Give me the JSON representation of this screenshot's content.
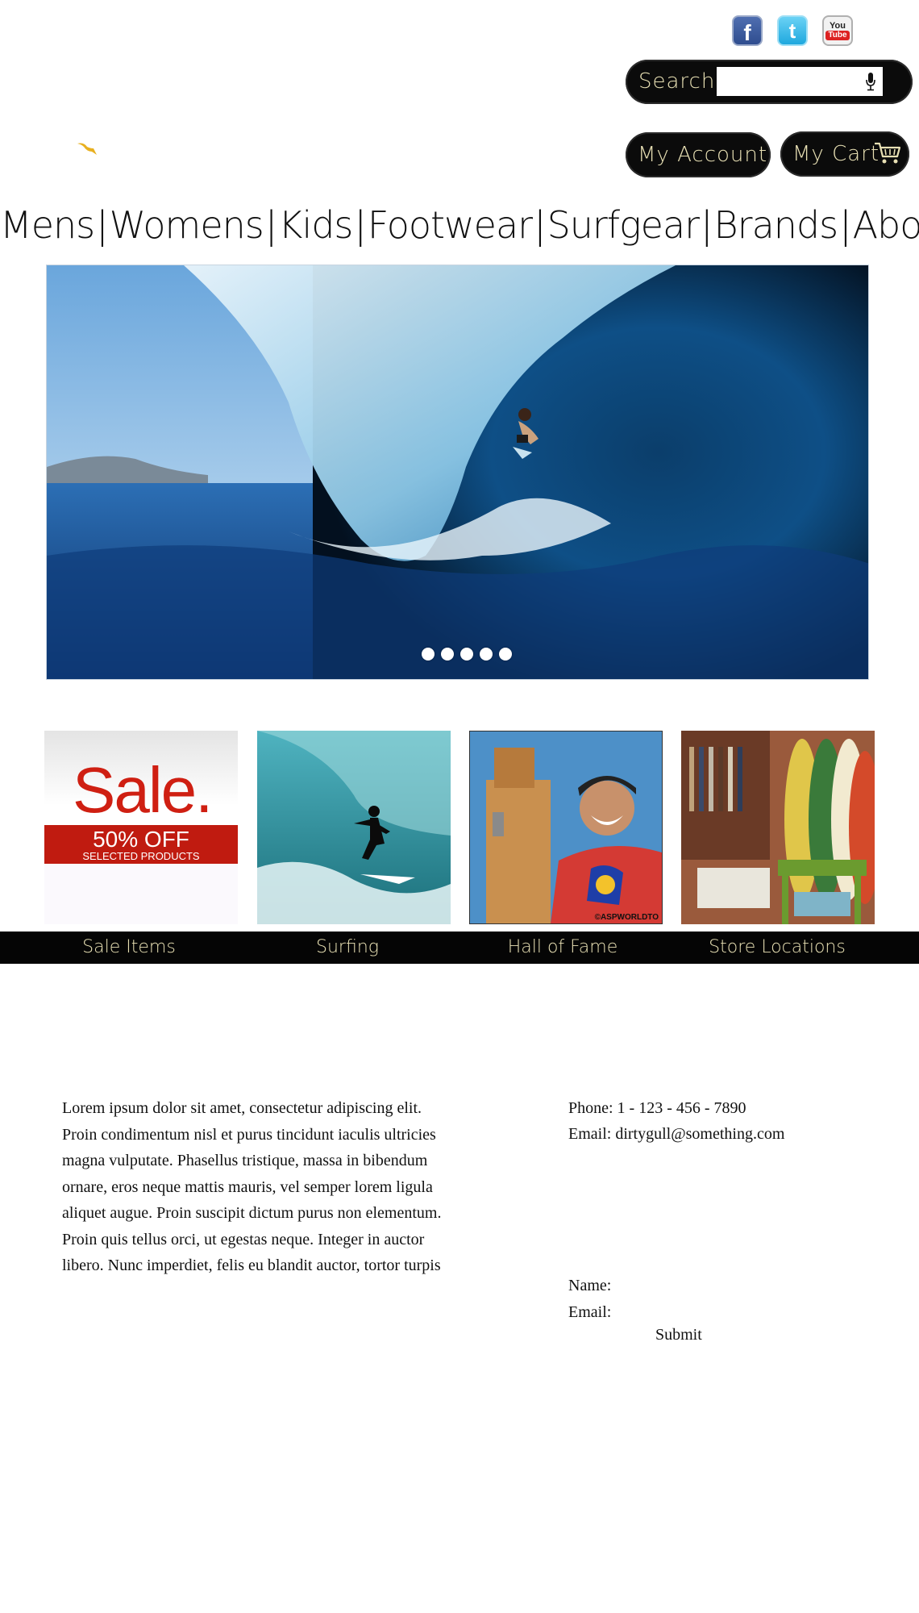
{
  "social": {
    "facebook_glyph": "f",
    "twitter_glyph": "t",
    "youtube_top": "You",
    "youtube_bottom": "Tube"
  },
  "search": {
    "label": "Search",
    "value": "",
    "placeholder": ""
  },
  "account": {
    "label": "My Account"
  },
  "cart": {
    "label": "My Cart"
  },
  "nav": {
    "items": [
      "Mens",
      "Womens",
      "Kids",
      "Footwear",
      "Surfgear",
      "Brands",
      "About"
    ],
    "separator": "|"
  },
  "hero": {
    "slide_count": 5,
    "active_slide": 1
  },
  "tiles": {
    "sale": {
      "word": "Sale.",
      "percent": "50% OFF",
      "sub": "SELECTED PRODUCTS"
    },
    "hall_watermark": "©ASPWORLDTO"
  },
  "categories": [
    "Sale Items",
    "Surfing",
    "Hall of Fame",
    "Store Locations"
  ],
  "body": {
    "lorem": "Lorem ipsum dolor sit amet, consectetur adipiscing elit. Proin condimentum nisl et purus tincidunt iaculis ultricies magna vulputate. Phasellus tristique, massa in bibendum ornare, eros neque mattis mauris, vel semper lorem ligula aliquet augue. Proin suscipit dictum purus non elementum. Proin quis tellus orci, ut egestas neque. Integer in auctor libero. Nunc imperdiet, felis eu blandit auctor, tortor turpis"
  },
  "contact": {
    "phone": "Phone: 1 - 123 - 456 - 7890",
    "email": "Email: dirtygull@something.com"
  },
  "form": {
    "name_label": "Name:",
    "email_label": "Email:",
    "name_value": "",
    "email_value": "",
    "submit_label": "Submit"
  },
  "colors": {
    "pill_bg": "#0b0b0b",
    "pill_text": "#e8e0b4",
    "sale_red": "#c01b10",
    "bird": "#e8b020"
  }
}
